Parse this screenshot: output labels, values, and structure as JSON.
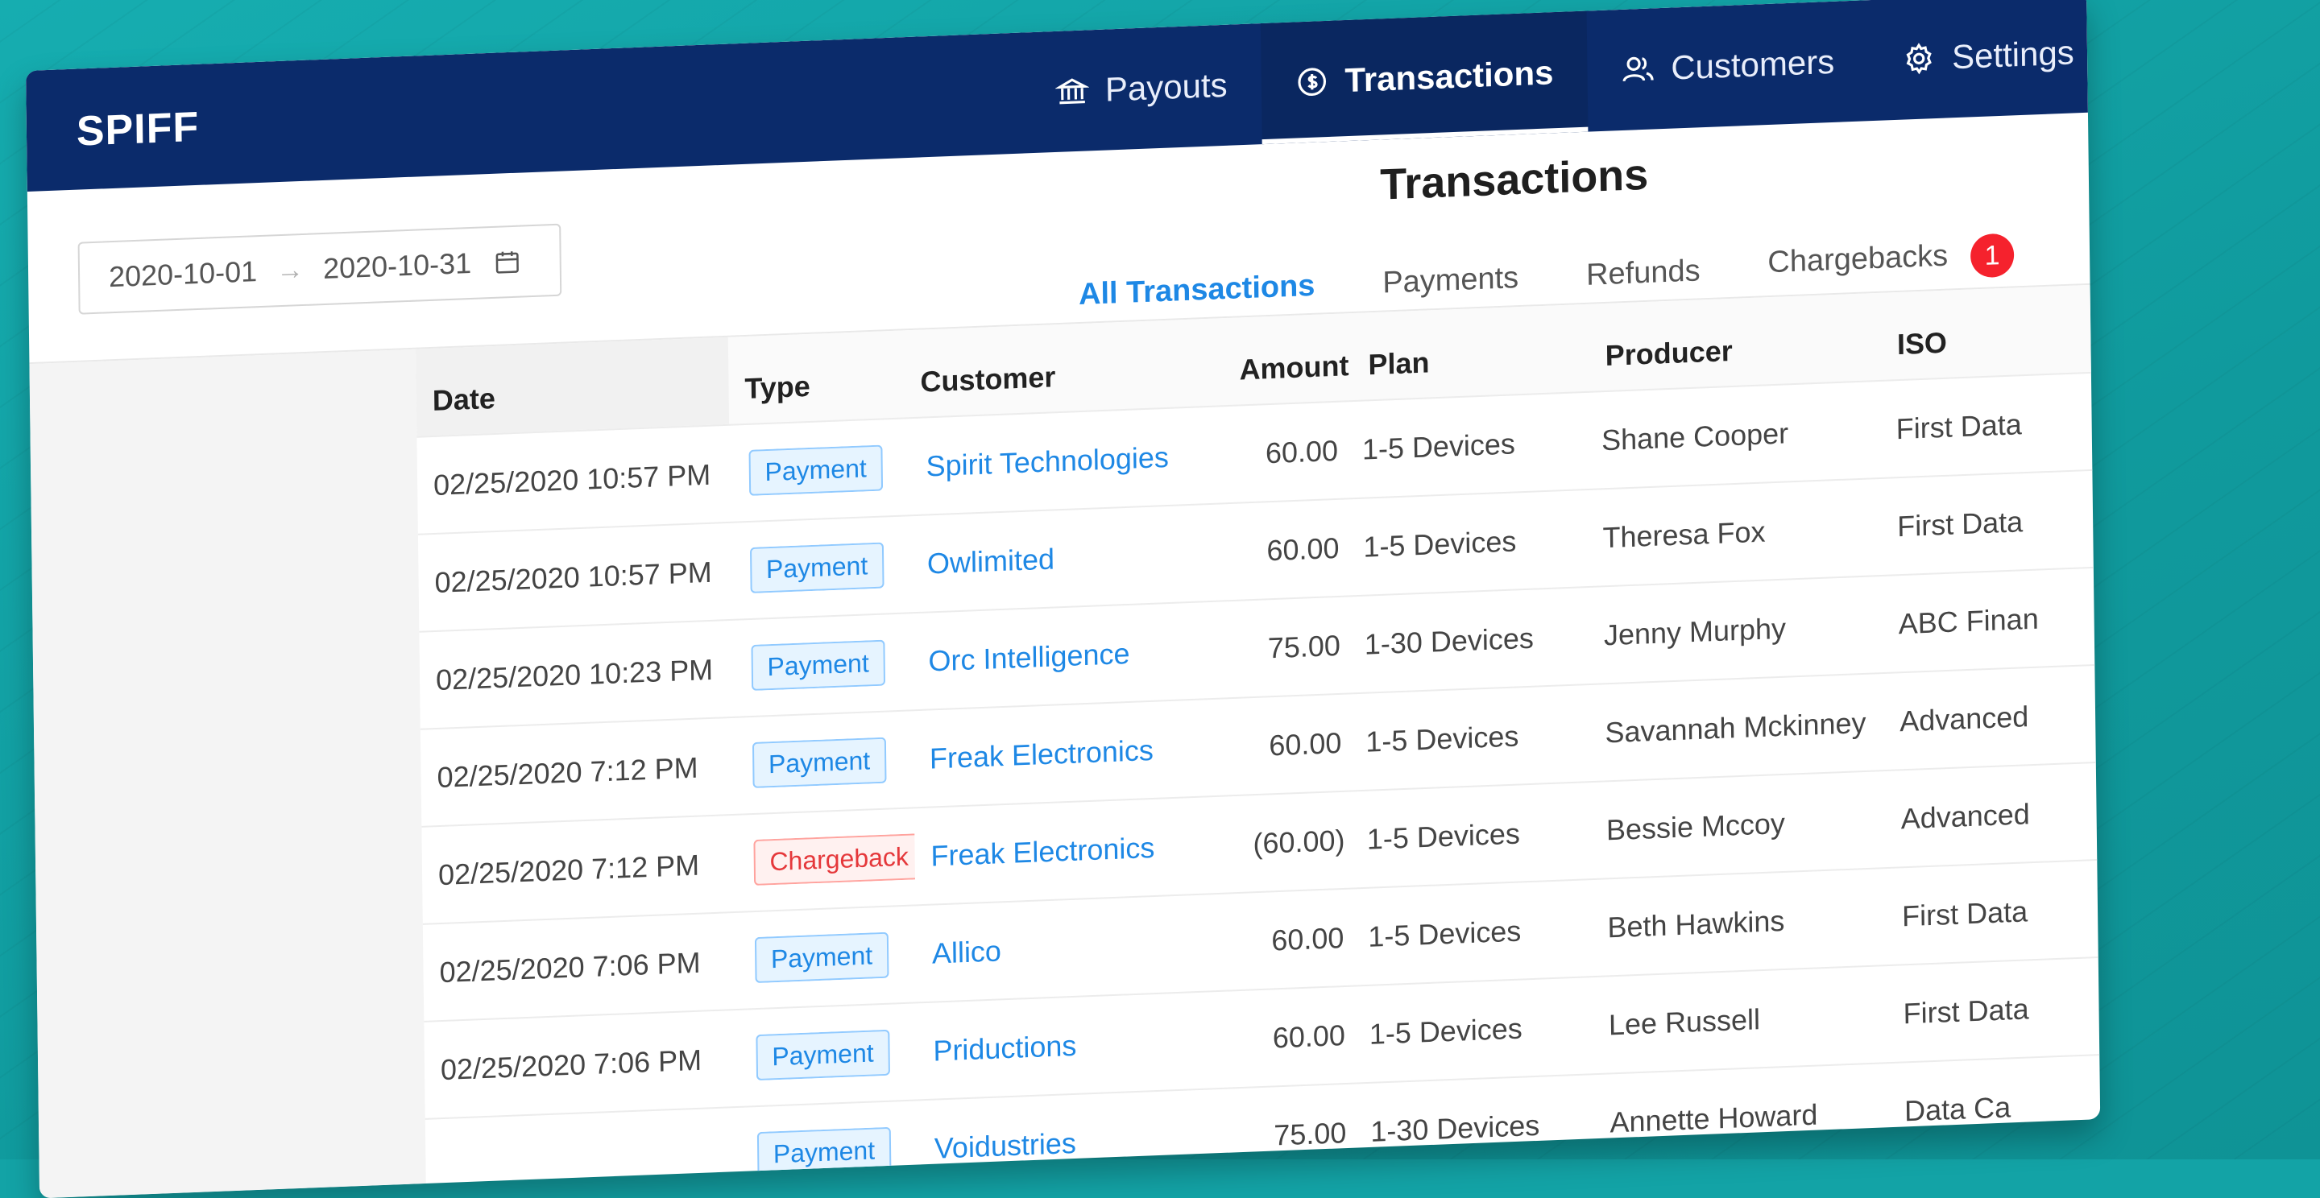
{
  "app": {
    "logo": "SPIFF"
  },
  "nav": [
    {
      "label": "Payouts",
      "icon": "bank-icon",
      "active": false
    },
    {
      "label": "Transactions",
      "icon": "dollar-circle-icon",
      "active": true
    },
    {
      "label": "Customers",
      "icon": "users-icon",
      "active": false
    },
    {
      "label": "Settings",
      "icon": "gear-icon",
      "active": false
    }
  ],
  "page": {
    "title": "Transactions"
  },
  "date_range": {
    "start": "2020-10-01",
    "end": "2020-10-31"
  },
  "tabs": {
    "all": "All Transactions",
    "payments": "Payments",
    "refunds": "Refunds",
    "chargebacks": "Chargebacks",
    "chargebacks_count": "1"
  },
  "table": {
    "columns": {
      "date": "Date",
      "type": "Type",
      "customer": "Customer",
      "amount": "Amount",
      "plan": "Plan",
      "producer": "Producer",
      "iso": "ISO"
    },
    "rows": [
      {
        "date": "02/25/2020 10:57 PM",
        "type": "Payment",
        "customer": "Spirit Technologies",
        "amount": "60.00",
        "plan": "1-5 Devices",
        "producer": "Shane Cooper",
        "iso": "First Data"
      },
      {
        "date": "02/25/2020 10:57 PM",
        "type": "Payment",
        "customer": "Owlimited",
        "amount": "60.00",
        "plan": "1-5 Devices",
        "producer": "Theresa Fox",
        "iso": "First Data"
      },
      {
        "date": "02/25/2020 10:23 PM",
        "type": "Payment",
        "customer": "Orc Intelligence",
        "amount": "75.00",
        "plan": "1-30 Devices",
        "producer": "Jenny Murphy",
        "iso": "ABC Finan"
      },
      {
        "date": "02/25/2020 7:12 PM",
        "type": "Payment",
        "customer": "Freak Electronics",
        "amount": "60.00",
        "plan": "1-5 Devices",
        "producer": "Savannah Mckinney",
        "iso": "Advanced"
      },
      {
        "date": "02/25/2020 7:12 PM",
        "type": "Chargeback",
        "customer": "Freak Electronics",
        "amount": "(60.00)",
        "plan": "1-5 Devices",
        "producer": "Bessie Mccoy",
        "iso": "Advanced"
      },
      {
        "date": "02/25/2020 7:06 PM",
        "type": "Payment",
        "customer": "Allico",
        "amount": "60.00",
        "plan": "1-5 Devices",
        "producer": "Beth Hawkins",
        "iso": "First Data"
      },
      {
        "date": "02/25/2020 7:06 PM",
        "type": "Payment",
        "customer": "Priductions",
        "amount": "60.00",
        "plan": "1-5 Devices",
        "producer": "Lee Russell",
        "iso": "First Data"
      },
      {
        "date": "",
        "type": "Payment",
        "customer": "Voidustries",
        "amount": "75.00",
        "plan": "1-30 Devices",
        "producer": "Annette Howard",
        "iso": "Data Ca"
      }
    ]
  },
  "colors": {
    "nav_bg": "#0b2b6b",
    "accent": "#1e88e5",
    "badge": "#f5222d",
    "background": "#13a3a6"
  }
}
